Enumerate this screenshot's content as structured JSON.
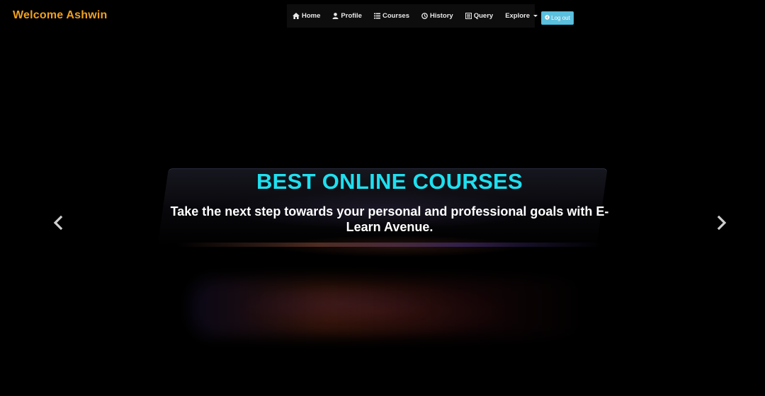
{
  "header": {
    "welcome_text": "Welcome Ashwin",
    "nav": {
      "home": "Home",
      "profile": "Profile",
      "courses": "Courses",
      "history": "History",
      "query": "Query",
      "explore": "Explore"
    },
    "logout_label": "Log out"
  },
  "hero": {
    "title": "BEST ONLINE COURSES",
    "subtitle": "Take the next step towards your personal and professional goals with E-Learn Avenue."
  },
  "icons": {
    "home": "home-icon",
    "profile": "user-icon",
    "courses": "list-icon",
    "history": "clock-icon",
    "query": "list-alt-icon",
    "logout": "logout-icon",
    "prev": "chevron-left-icon",
    "next": "chevron-right-icon"
  },
  "colors": {
    "brand": "#f0a020",
    "hero_title": "#1ee0f0",
    "logout_button": "#5bc0de",
    "background": "#000000"
  }
}
